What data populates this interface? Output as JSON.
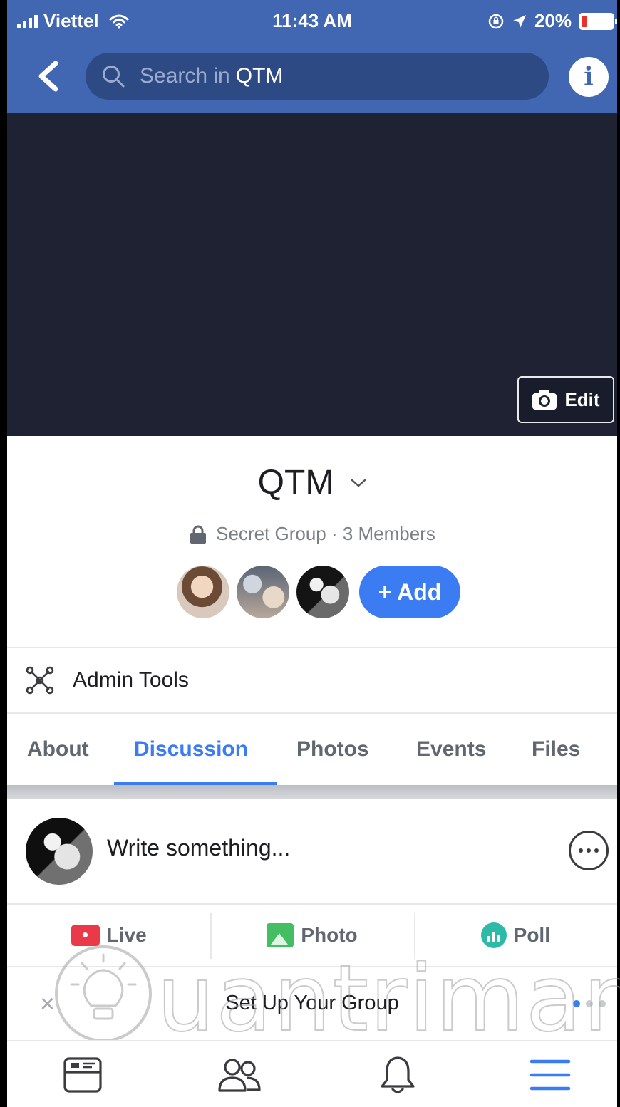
{
  "status_bar": {
    "carrier": "Viettel",
    "time": "11:43 AM",
    "battery_text": "20%",
    "battery_level": 0.2,
    "icons": [
      "signal-icon",
      "wifi-icon",
      "lock-rotation-icon",
      "location-icon",
      "battery-icon"
    ]
  },
  "header": {
    "search_prefix": "Search in",
    "search_term": "QTM",
    "info_label": "i",
    "colors": {
      "bar": "#4167b2",
      "search_field": "#2e4a85"
    }
  },
  "cover": {
    "edit_label": "Edit"
  },
  "group": {
    "name": "QTM",
    "meta": "Secret Group · 3 Members",
    "add_label": "+ Add"
  },
  "admin_tools": {
    "label": "Admin Tools"
  },
  "tabs": [
    {
      "label": "About",
      "active": false
    },
    {
      "label": "Discussion",
      "active": true
    },
    {
      "label": "Photos",
      "active": false
    },
    {
      "label": "Events",
      "active": false
    },
    {
      "label": "Files",
      "active": false
    }
  ],
  "composer": {
    "placeholder": "Write something...",
    "actions": [
      {
        "label": "Live",
        "icon": "live-video-icon"
      },
      {
        "label": "Photo",
        "icon": "photo-icon"
      },
      {
        "label": "Poll",
        "icon": "poll-icon"
      }
    ]
  },
  "setup": {
    "title": "Set Up Your Group",
    "close": "×"
  },
  "watermark": {
    "text": "uantrimang"
  },
  "accent_color": "#3b7cf2"
}
